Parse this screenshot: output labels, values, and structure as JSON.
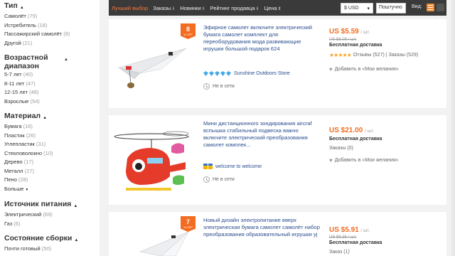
{
  "sidebar": {
    "groups": [
      {
        "title": "Тип",
        "items": [
          {
            "label": "Самолёт",
            "count": "(79)"
          },
          {
            "label": "Истребитель",
            "count": "(18)"
          },
          {
            "label": "Пассажирский самолёт",
            "count": "(8)"
          },
          {
            "label": "Другой",
            "count": "(21)"
          }
        ]
      },
      {
        "title": "Возрастной диапазон",
        "items": [
          {
            "label": "5-7 лет",
            "count": "(40)"
          },
          {
            "label": "8-11 лет",
            "count": "(47)"
          },
          {
            "label": "12-15 лет",
            "count": "(48)"
          },
          {
            "label": "Взрослые",
            "count": "(54)"
          }
        ]
      },
      {
        "title": "Материал",
        "items": [
          {
            "label": "Бумага",
            "count": "(16)"
          },
          {
            "label": "Пластик",
            "count": "(26)"
          },
          {
            "label": "Углепластик",
            "count": "(31)"
          },
          {
            "label": "Стекловолокно",
            "count": "(10)"
          },
          {
            "label": "Дерево",
            "count": "(17)"
          },
          {
            "label": "Металл",
            "count": "(27)"
          },
          {
            "label": "Пено",
            "count": "(28)"
          }
        ],
        "more": "Больше"
      },
      {
        "title": "Источник питания",
        "items": [
          {
            "label": "Электрический",
            "count": "(69)"
          },
          {
            "label": "Газ",
            "count": "(6)"
          }
        ]
      },
      {
        "title": "Состояние сборки",
        "items": [
          {
            "label": "Почти готовый",
            "count": "(50)"
          }
        ]
      }
    ]
  },
  "sortbar": {
    "best": "Лучший выбор",
    "orders": "Заказы",
    "new": "Новинки",
    "rating": "Рейтинг продавца",
    "price": "Цена",
    "currency": "$ USD",
    "shipping": "Поштучно",
    "view_label": "Вид:"
  },
  "products": [
    {
      "badge_pct": "8",
      "badge_off": "% OFF",
      "title": "Эфирное самолет включите электрический бумага самолет комплект для переоборудования мода развивающие игрушки большой подарок 624",
      "store": "Sunshine Outdoors Store",
      "offline": "Не в сети",
      "price": "US $5.59",
      "unit": "/ шт.",
      "old_price": "US $6.08 / шт.",
      "freeship": "Бесплатная доставка",
      "reviews": "Отзывы (527)",
      "orders": "Заказы (529)",
      "wish": "Добавить в «Мои желания»"
    },
    {
      "title": "Мини дистанционного зондирования aircraf вспышка стабильный подвеска важно включите электрический преобразования самолет комплек...",
      "store": "welcome to welcome",
      "offline": "Не в сети",
      "price": "US $21.00",
      "unit": "/ шт.",
      "freeship": "Бесплатная доставка",
      "orders": "Заказы (0)",
      "wish": "Добавить в «Мои желания»"
    },
    {
      "badge_pct": "7",
      "badge_off": "% OFF",
      "title": "Новый дизайн электропитание вверх электрическая бумага самолет самолёт набор преобразования образовательный игрушки yj",
      "price": "US $5.91",
      "unit": "/ шт.",
      "old_price": "US $6.35 / шт.",
      "freeship": "Бесплатная доставка",
      "orders": "Заказ (1)"
    }
  ]
}
